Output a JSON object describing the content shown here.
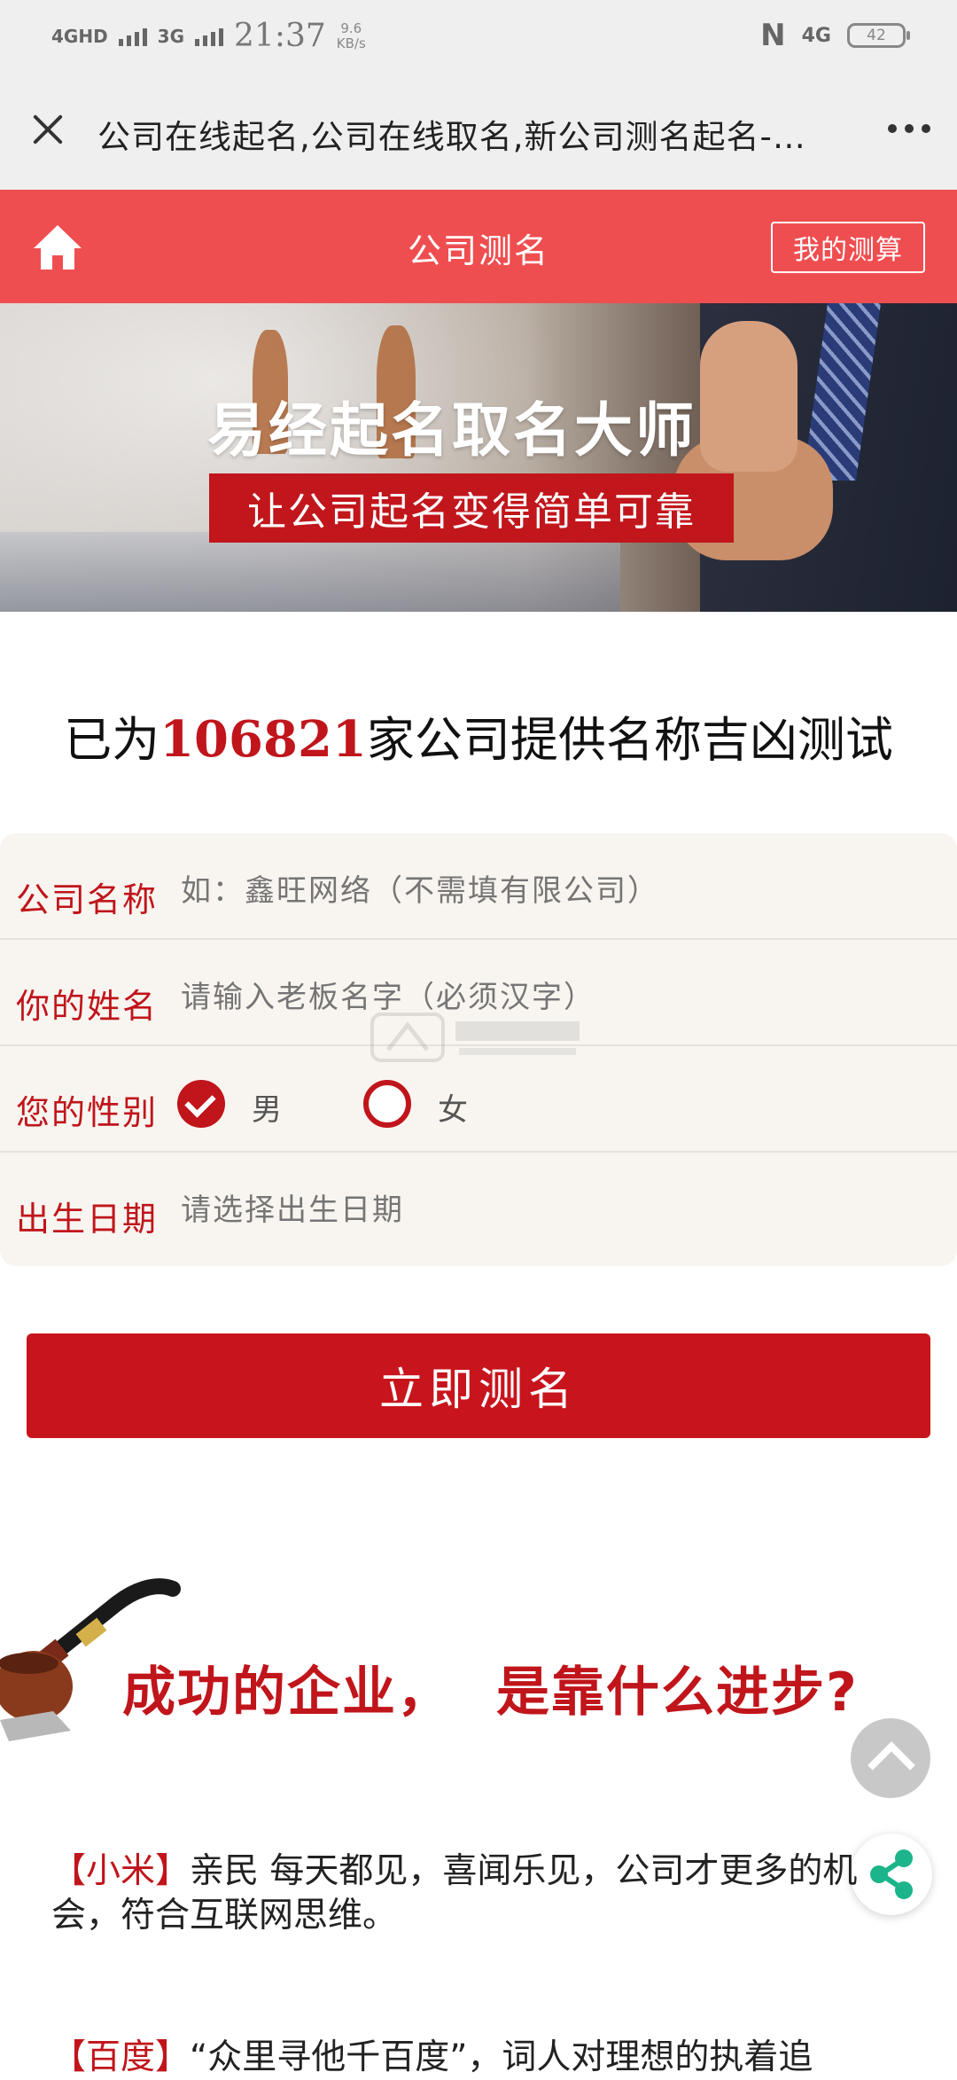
{
  "status_bar": {
    "network1": "4GHD",
    "network2": "3G",
    "time": "21:37",
    "speed_value": "9.6",
    "speed_unit": "KB/s",
    "network_right": "4G",
    "battery": "42"
  },
  "title_bar": {
    "title": "公司在线起名,公司在线取名,新公司测名起名-…"
  },
  "nav": {
    "title": "公司测名",
    "my_test": "我的测算"
  },
  "banner": {
    "title": "易经起名取名大师",
    "subtitle": "让公司起名变得简单可靠"
  },
  "stats": {
    "prefix": "已为",
    "count": "106821",
    "suffix": "家公司提供名称吉凶测试"
  },
  "form": {
    "company_label": "公司名称",
    "company_placeholder": "如：鑫旺网络（不需填有限公司）",
    "name_label": "你的姓名",
    "name_placeholder": "请输入老板名字（必须汉字）",
    "gender_label": "您的性别",
    "male": "男",
    "female": "女",
    "gender_selected": "男",
    "birth_label": "出生日期",
    "birth_placeholder": "请选择出生日期"
  },
  "submit_label": "立即测名",
  "section": {
    "heading_part1": "成功的企业，",
    "heading_part2": "是靠什么进步?"
  },
  "paragraphs": [
    {
      "brand": "【小米】",
      "text": "亲民 每天都见，喜闻乐见，公司才更多的机会，符合互联网思维。"
    },
    {
      "brand": "【百度】",
      "text": "“众里寻他千百度”，词人对理想的执着追"
    }
  ],
  "icons": {
    "close": "close-icon",
    "more": "more-icon",
    "home": "home-icon",
    "scroll_top": "chevron-up-icon",
    "share": "share-icon"
  },
  "colors": {
    "nav_red": "#ef4e50",
    "accent_red": "#c0151b",
    "button_red": "#c8141c",
    "share_green": "#1cb48a"
  }
}
